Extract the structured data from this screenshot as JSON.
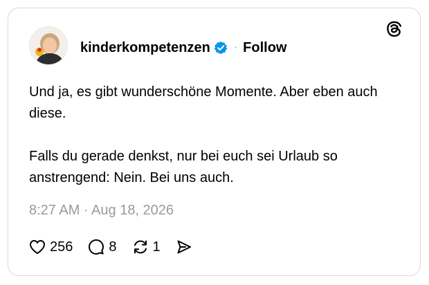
{
  "post": {
    "username": "kinderkompetenzen",
    "verified_icon": "verified-badge-icon",
    "separator": "·",
    "follow_label": "Follow",
    "paragraphs": [
      "Und ja, es gibt wunderschöne Momente. Aber eben auch diese.",
      "Falls du gerade denkst, nur bei euch sei Urlaub so anstrengend: Nein. Bei uns auch."
    ],
    "timestamp": "8:27 AM · Aug 18, 2026"
  },
  "actions": {
    "likes": "256",
    "replies": "8",
    "reposts": "1"
  },
  "icons": {
    "brand": "threads-logo-icon",
    "like": "heart-icon",
    "reply": "speech-bubble-icon",
    "repost": "repost-icon",
    "share": "send-icon"
  },
  "colors": {
    "verified": "#0095f6",
    "border": "#d9d9d9",
    "muted_text": "#9a9a9a"
  }
}
